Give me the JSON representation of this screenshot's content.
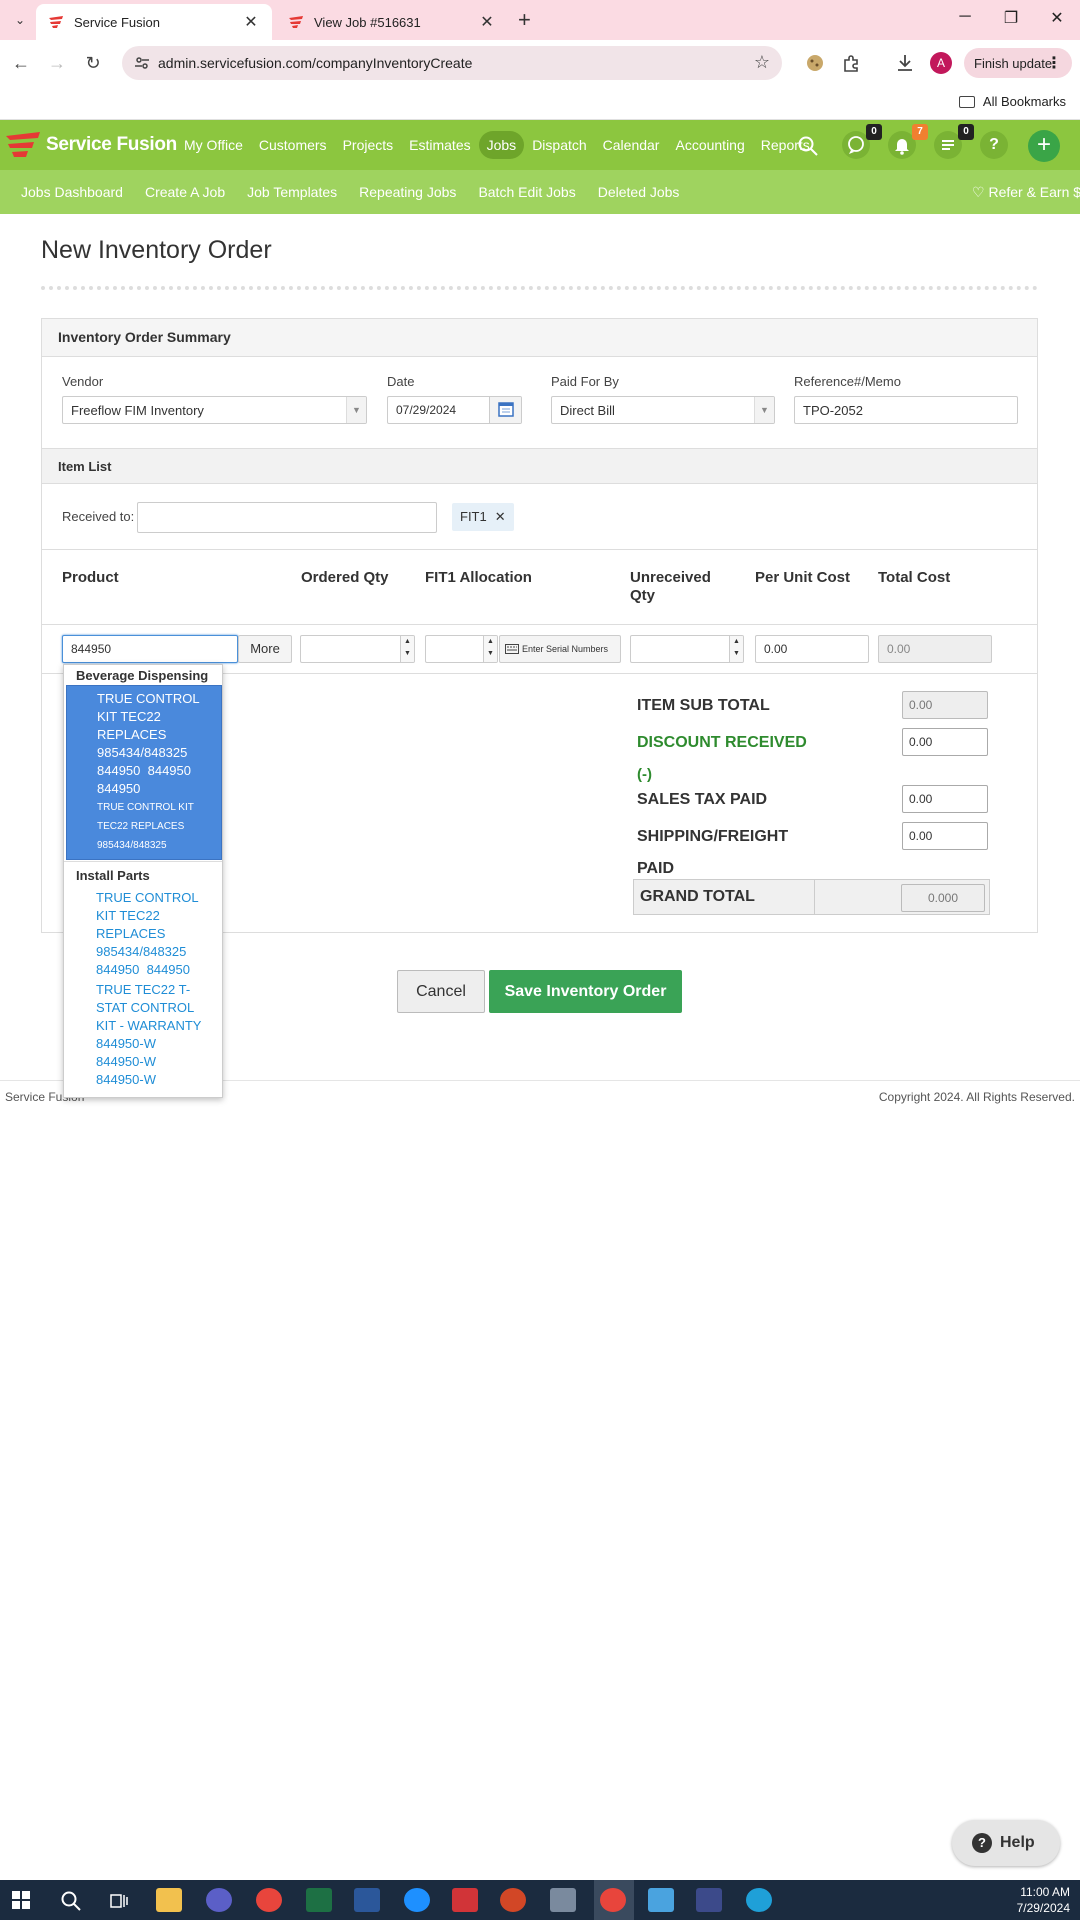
{
  "browser": {
    "tabs": [
      {
        "title": "Service Fusion",
        "active": true
      },
      {
        "title": "View Job #516631",
        "active": false
      }
    ],
    "url": "admin.servicefusion.com/companyInventoryCreate",
    "finish_update": "Finish update",
    "profile_initial": "A",
    "all_bookmarks": "All Bookmarks"
  },
  "app": {
    "brand": "Service Fusion",
    "nav": [
      "My Office",
      "Customers",
      "Projects",
      "Estimates",
      "Jobs",
      "Dispatch",
      "Calendar",
      "Accounting",
      "Reports"
    ],
    "active_nav": "Jobs",
    "badges": {
      "chat": "0",
      "notifications": "7",
      "tasks": "0"
    },
    "subnav": [
      "Jobs Dashboard",
      "Create A Job",
      "Job Templates",
      "Repeating Jobs",
      "Batch Edit Jobs",
      "Deleted Jobs"
    ],
    "refer": "Refer & Earn $"
  },
  "page": {
    "title": "New Inventory Order",
    "summary_heading": "Inventory Order Summary",
    "vendor_label": "Vendor",
    "vendor_value": "Freeflow FIM Inventory",
    "date_label": "Date",
    "date_value": "07/29/2024",
    "paid_label": "Paid For By",
    "paid_value": "Direct Bill",
    "ref_label": "Reference#/Memo",
    "ref_value": "TPO-2052",
    "item_list_heading": "Item List",
    "received_label": "Received to:",
    "received_chip": "FIT1",
    "columns": {
      "product": "Product",
      "ordered": "Ordered Qty",
      "allocation": "FIT1 Allocation",
      "unreceived": "Unreceived Qty",
      "unit_cost": "Per Unit Cost",
      "total_cost": "Total Cost"
    },
    "row": {
      "product": "844950",
      "more": "More",
      "serial_btn": "Enter Serial Numbers",
      "unit_cost": "0.00",
      "total_cost": "0.00"
    },
    "totals": {
      "subtotal_label": "ITEM SUB TOTAL",
      "subtotal": "0.00",
      "discount_label": "DISCOUNT RECEIVED",
      "discount_sign": "(-)",
      "discount": "0.00",
      "tax_label": "SALES TAX PAID",
      "tax": "0.00",
      "shipping_label_1": "SHIPPING/FREIGHT",
      "shipping_label_2": "PAID",
      "shipping": "0.00",
      "grand_label": "GRAND TOTAL",
      "grand": "0.000"
    },
    "cancel": "Cancel",
    "save": "Save Inventory Order"
  },
  "autocomplete": {
    "group1": "Beverage Dispensing",
    "group1_item_lines": [
      "TRUE CONTROL",
      "KIT TEC22",
      "REPLACES",
      "985434/848325",
      "844950  844950",
      "844950"
    ],
    "group1_item_small": [
      "TRUE CONTROL KIT",
      "TEC22 REPLACES",
      "985434/848325"
    ],
    "group2": "Install Parts",
    "group2_item1_lines": [
      "TRUE CONTROL",
      "KIT TEC22",
      "REPLACES",
      "985434/848325",
      "844950  844950"
    ],
    "group2_item2_lines": [
      "TRUE TEC22 T-",
      "STAT CONTROL",
      "KIT - WARRANTY",
      "844950-W",
      "844950-W",
      "844950-W"
    ]
  },
  "footer": {
    "left": "Service Fusion",
    "right": "Copyright 2024. All Rights Reserved."
  },
  "help": "Help",
  "taskbar": {
    "time": "11:00 AM",
    "date": "7/29/2024"
  }
}
